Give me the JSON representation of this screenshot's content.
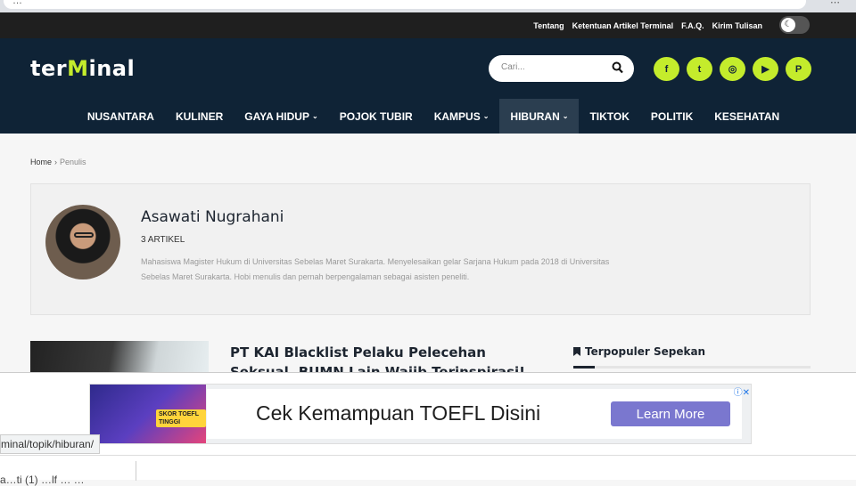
{
  "browser": {
    "url_fragment": "…",
    "icons": "⋯"
  },
  "topbar": {
    "links": [
      "Tentang",
      "Ketentuan Artikel Terminal",
      "F.A.Q.",
      "Kirim Tulisan"
    ],
    "theme_toggle_icon": "moon-icon"
  },
  "header": {
    "logo_prefix": "ter",
    "logo_mark": "M",
    "logo_suffix": "inal",
    "search_placeholder": "Cari...",
    "socials": [
      {
        "name": "facebook-icon",
        "glyph": "f"
      },
      {
        "name": "twitter-icon",
        "glyph": "t"
      },
      {
        "name": "instagram-icon",
        "glyph": "◎"
      },
      {
        "name": "youtube-icon",
        "glyph": "▶"
      },
      {
        "name": "pinterest-icon",
        "glyph": "P"
      }
    ],
    "accent_color": "#c4ec2c"
  },
  "nav": {
    "items": [
      {
        "label": "NUSANTARA"
      },
      {
        "label": "KULINER"
      },
      {
        "label": "GAYA HIDUP",
        "dropdown": true
      },
      {
        "label": "POJOK TUBIR"
      },
      {
        "label": "KAMPUS",
        "dropdown": true
      },
      {
        "label": "HIBURAN",
        "dropdown": true,
        "active": true
      },
      {
        "label": "TIKTOK"
      },
      {
        "label": "POLITIK"
      },
      {
        "label": "KESEHATAN"
      }
    ]
  },
  "breadcrumb": {
    "home": "Home",
    "separator": "›",
    "current": "Penulis"
  },
  "author": {
    "name": "Asawati Nugrahani",
    "article_count": "3 ARTIKEL",
    "bio": "Mahasiswa Magister Hukum di Universitas Sebelas Maret Surakarta. Menyelesaikan gelar Sarjana Hukum pada 2018 di Universitas Sebelas Maret Surakarta. Hobi menulis dan pernah berpengalaman sebagai asisten peneliti."
  },
  "article": {
    "title": "PT KAI Blacklist Pelaku Pelecehan Seksual, BUMN Lain Wajib Terinspirasi!"
  },
  "sidebar": {
    "heading": "Terpopuler Sepekan"
  },
  "ad": {
    "badge": "SKOR TOEFL TINGGI",
    "headline": "Cek Kemampuan TOEFL Disini",
    "cta": "Learn More",
    "corner": "ⓘ✕"
  },
  "status_bar": {
    "url": "minal/topik/hiburan/"
  },
  "bottom": {
    "text": "a…ti (1) …lf … …"
  }
}
